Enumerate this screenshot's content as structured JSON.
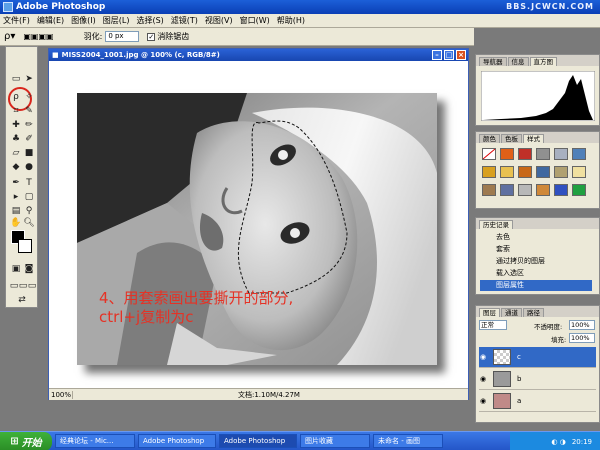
{
  "app": {
    "title": "Adobe Photoshop",
    "watermark": "BBS.JCWCN.COM"
  },
  "menu": {
    "items": [
      "文件(F)",
      "编辑(E)",
      "图像(I)",
      "图层(L)",
      "选择(S)",
      "滤镜(T)",
      "视图(V)",
      "窗口(W)",
      "帮助(H)"
    ]
  },
  "options": {
    "feather_label": "羽化:",
    "feather_value": "0 px",
    "antialias_label": "消除锯齿"
  },
  "document": {
    "title": "MISS2004_1001.jpg @ 100% (c, RGB/8#)",
    "zoom": "100%",
    "doc_info": "文档:1.10M/4.27M",
    "caption_line1": "4、用套索画出要撕开的部分,",
    "caption_line2": "ctrl+j复制为c"
  },
  "navigator_panel": {
    "tabs": [
      "导航器",
      "信息",
      "直方图"
    ]
  },
  "swatches_panel": {
    "tabs": [
      "颜色",
      "色板",
      "样式"
    ]
  },
  "history_panel": {
    "tabs": [
      "历史记录"
    ],
    "items": [
      "去色",
      "套索",
      "通过拷贝的图层",
      "载入选区",
      "图层属性"
    ]
  },
  "layers_panel": {
    "tabs": [
      "图层",
      "通道",
      "路径"
    ],
    "blend_mode": "正常",
    "opacity_label": "不透明度:",
    "opacity_value": "100%",
    "fill_label": "填充:",
    "fill_value": "100%",
    "layers": [
      {
        "name": "c"
      },
      {
        "name": "b"
      },
      {
        "name": "a"
      }
    ]
  },
  "taskbar": {
    "start_label": "开始",
    "tasks": [
      "经典论坛 - Mic...",
      "Adobe Photoshop",
      "Adobe Photoshop",
      "图片收藏",
      "未命名 - 画图"
    ],
    "clock": "20:19"
  },
  "colors": {
    "caption": "#e53225",
    "title_blue": "#1c5fd8",
    "selection": "#3169c6"
  }
}
